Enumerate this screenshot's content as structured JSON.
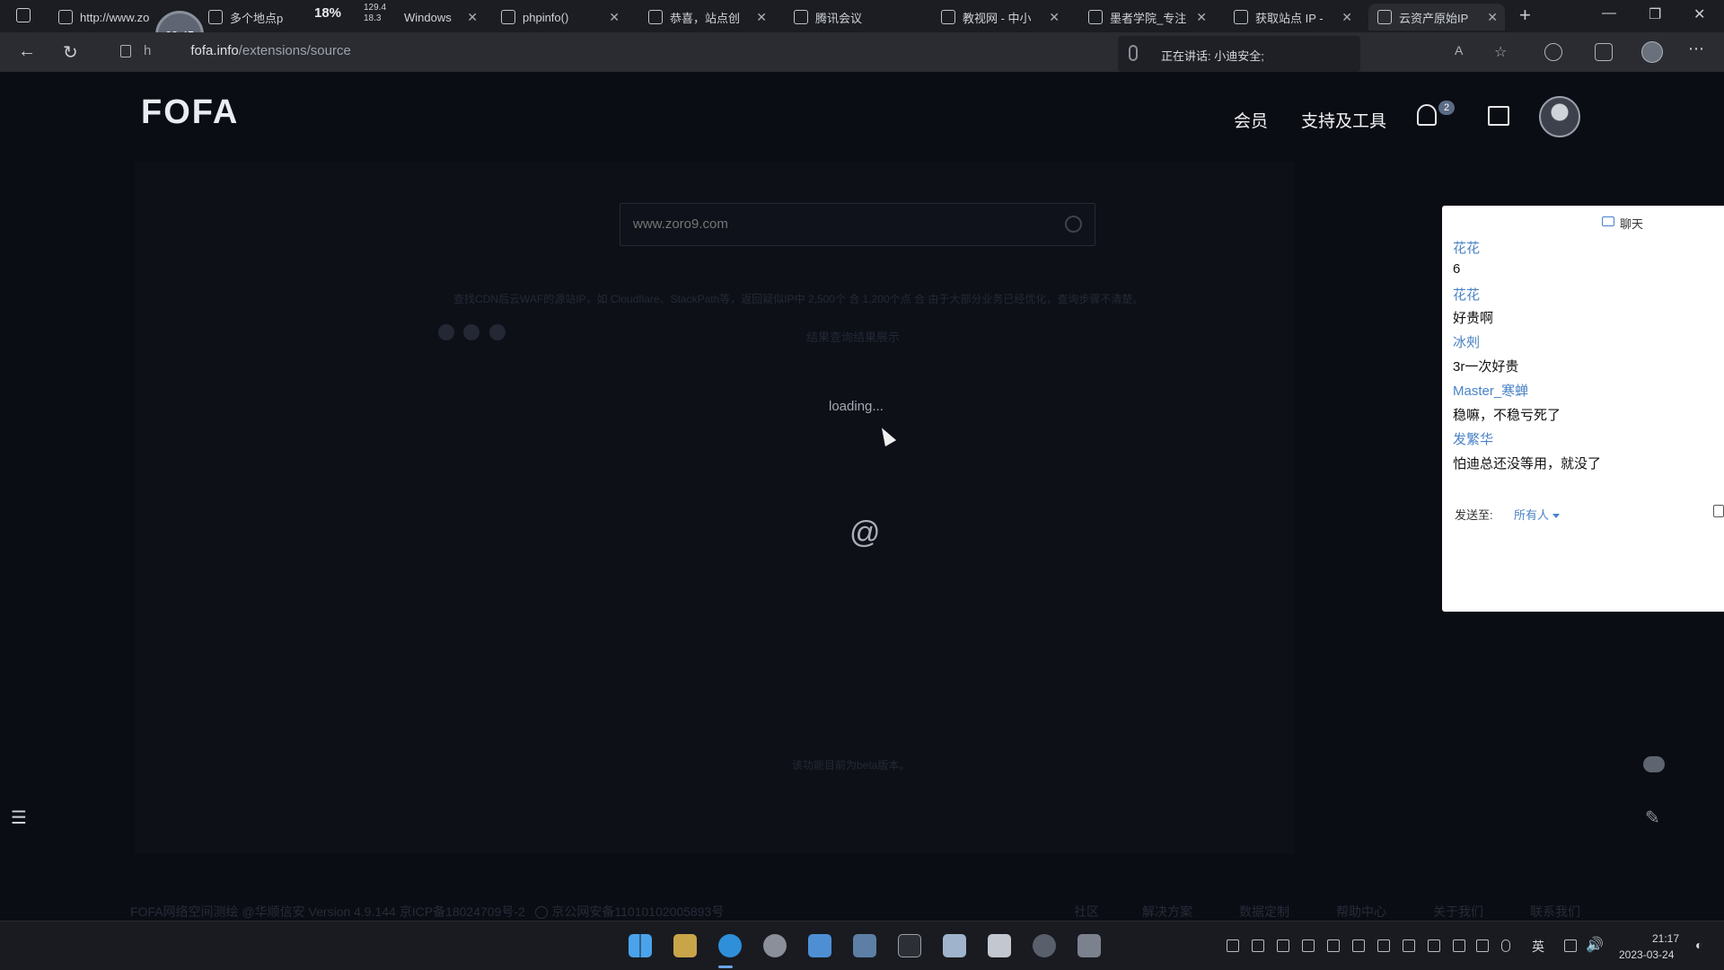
{
  "browser": {
    "tabs": [
      {
        "label": "http://www.zo"
      },
      {
        "label": "多个地点p"
      },
      {
        "label": "Windows"
      },
      {
        "label": "phpinfo()"
      },
      {
        "label": "恭喜，站点创"
      },
      {
        "label": "腾讯会议"
      },
      {
        "label": "教视网 - 中小"
      },
      {
        "label": "墨者学院_专注"
      },
      {
        "label": "获取站点 IP -"
      },
      {
        "label": "云资产原始IP"
      }
    ],
    "tab_widget_values": {
      "percent": "18%",
      "speed_up": "129.4",
      "speed_down": "18.3"
    },
    "url_prefix": "h",
    "url_host": "fofa.info",
    "url_path": "/extensions/source",
    "speaking_label": "正在讲话: 小迪安全;",
    "timer": "60:45"
  },
  "header": {
    "logo": "FOFA",
    "nav_member": "会员",
    "nav_tools": "支持及工具",
    "notification_count": "2"
  },
  "main": {
    "search_placeholder": "www.zoro9.com",
    "description": "查找CDN后云WAF的源站IP，如 Cloudflare、StackPath等，返回疑似IP中 2,500个 合 1,200个点 合 由于大部分业务已经优化，查询步骤不清楚。",
    "result_label": "结果查询结果展示",
    "loading_text": "loading...",
    "beta_note": "该功能目前为beta版本。"
  },
  "footer": {
    "copyright": "FOFA网络空间测绘 @华顺信安 Version 4.9.144 京ICP备18024709号-2",
    "police_record": "京公网安备11010102005893号",
    "links": [
      "社区",
      "解决方案",
      "数据定制",
      "帮助中心",
      "关于我们",
      "联系我们"
    ]
  },
  "chat": {
    "title": "聊天",
    "messages": [
      {
        "name": "花花",
        "text": "6"
      },
      {
        "name": "花花",
        "text": "好贵啊"
      },
      {
        "name": "冰㓨",
        "text": "3r一次好贵"
      },
      {
        "name": "Master_寒蝉",
        "text": "稳嘛，不稳亏死了"
      },
      {
        "name": "发繁华",
        "text": "怕迪总还没等用，就没了"
      }
    ],
    "send_to_label": "发送至:",
    "send_to_value": "所有人"
  },
  "taskbar": {
    "lang": "英",
    "time": "21:17",
    "date": "2023-03-24"
  },
  "colors": {
    "chat_name": "#4a83c6",
    "page_bg": "#0b0d14",
    "chrome_bg": "#2a2c32",
    "taskbar_bg": "#191b20"
  }
}
